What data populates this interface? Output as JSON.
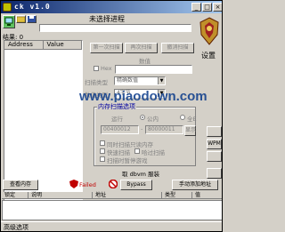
{
  "window": {
    "title": "ckvs1.0",
    "title_display": "ck v1.0"
  },
  "process": {
    "label": "未选择进程"
  },
  "results": {
    "found_label": "结果: 0",
    "columns": [
      "Address",
      "Value"
    ]
  },
  "scan": {
    "first_scan": "第一次扫描",
    "next_scan": "再次扫描",
    "undo_scan": "撤消扫描",
    "value_label": "数值",
    "hex_label": "Hex",
    "scan_type_label": "扫描类型",
    "scan_type_value": "精确数值",
    "value_type_label": "数值类型",
    "value_type_value": "4字节"
  },
  "memory_options": {
    "title": "内存扫描选项",
    "mode_label": "运行",
    "radio_custom": "公内",
    "radio_all": "全E",
    "start_address": "00400012",
    "end_address": "80000011",
    "show_button": "显示",
    "checkbox_thread": "同时扫描只读内存",
    "checkbox_fast": "快速扫描",
    "checkbox_hide": "哈过扫描",
    "checkbox_pause": "扫描时暂停游戏",
    "wpm_label": "WPM"
  },
  "dbvm": {
    "label": "取 dbvm 服装"
  },
  "buttons": {
    "view_memory": "查看内存",
    "failed": "Failed",
    "bypass": "Bypass",
    "add_address_manually": "手动添加地址"
  },
  "address_table": {
    "columns": [
      "锁定",
      "说明",
      "地址",
      "类型",
      "值"
    ]
  },
  "status": {
    "advanced_options": "高级选项"
  },
  "settings": {
    "label": "设置"
  },
  "watermark": {
    "text": "www.piaodown.com"
  },
  "icons": {
    "open_process": "computer-icon",
    "open_file": "folder-icon",
    "save": "disk-icon",
    "logo": "lion-crest-icon"
  }
}
